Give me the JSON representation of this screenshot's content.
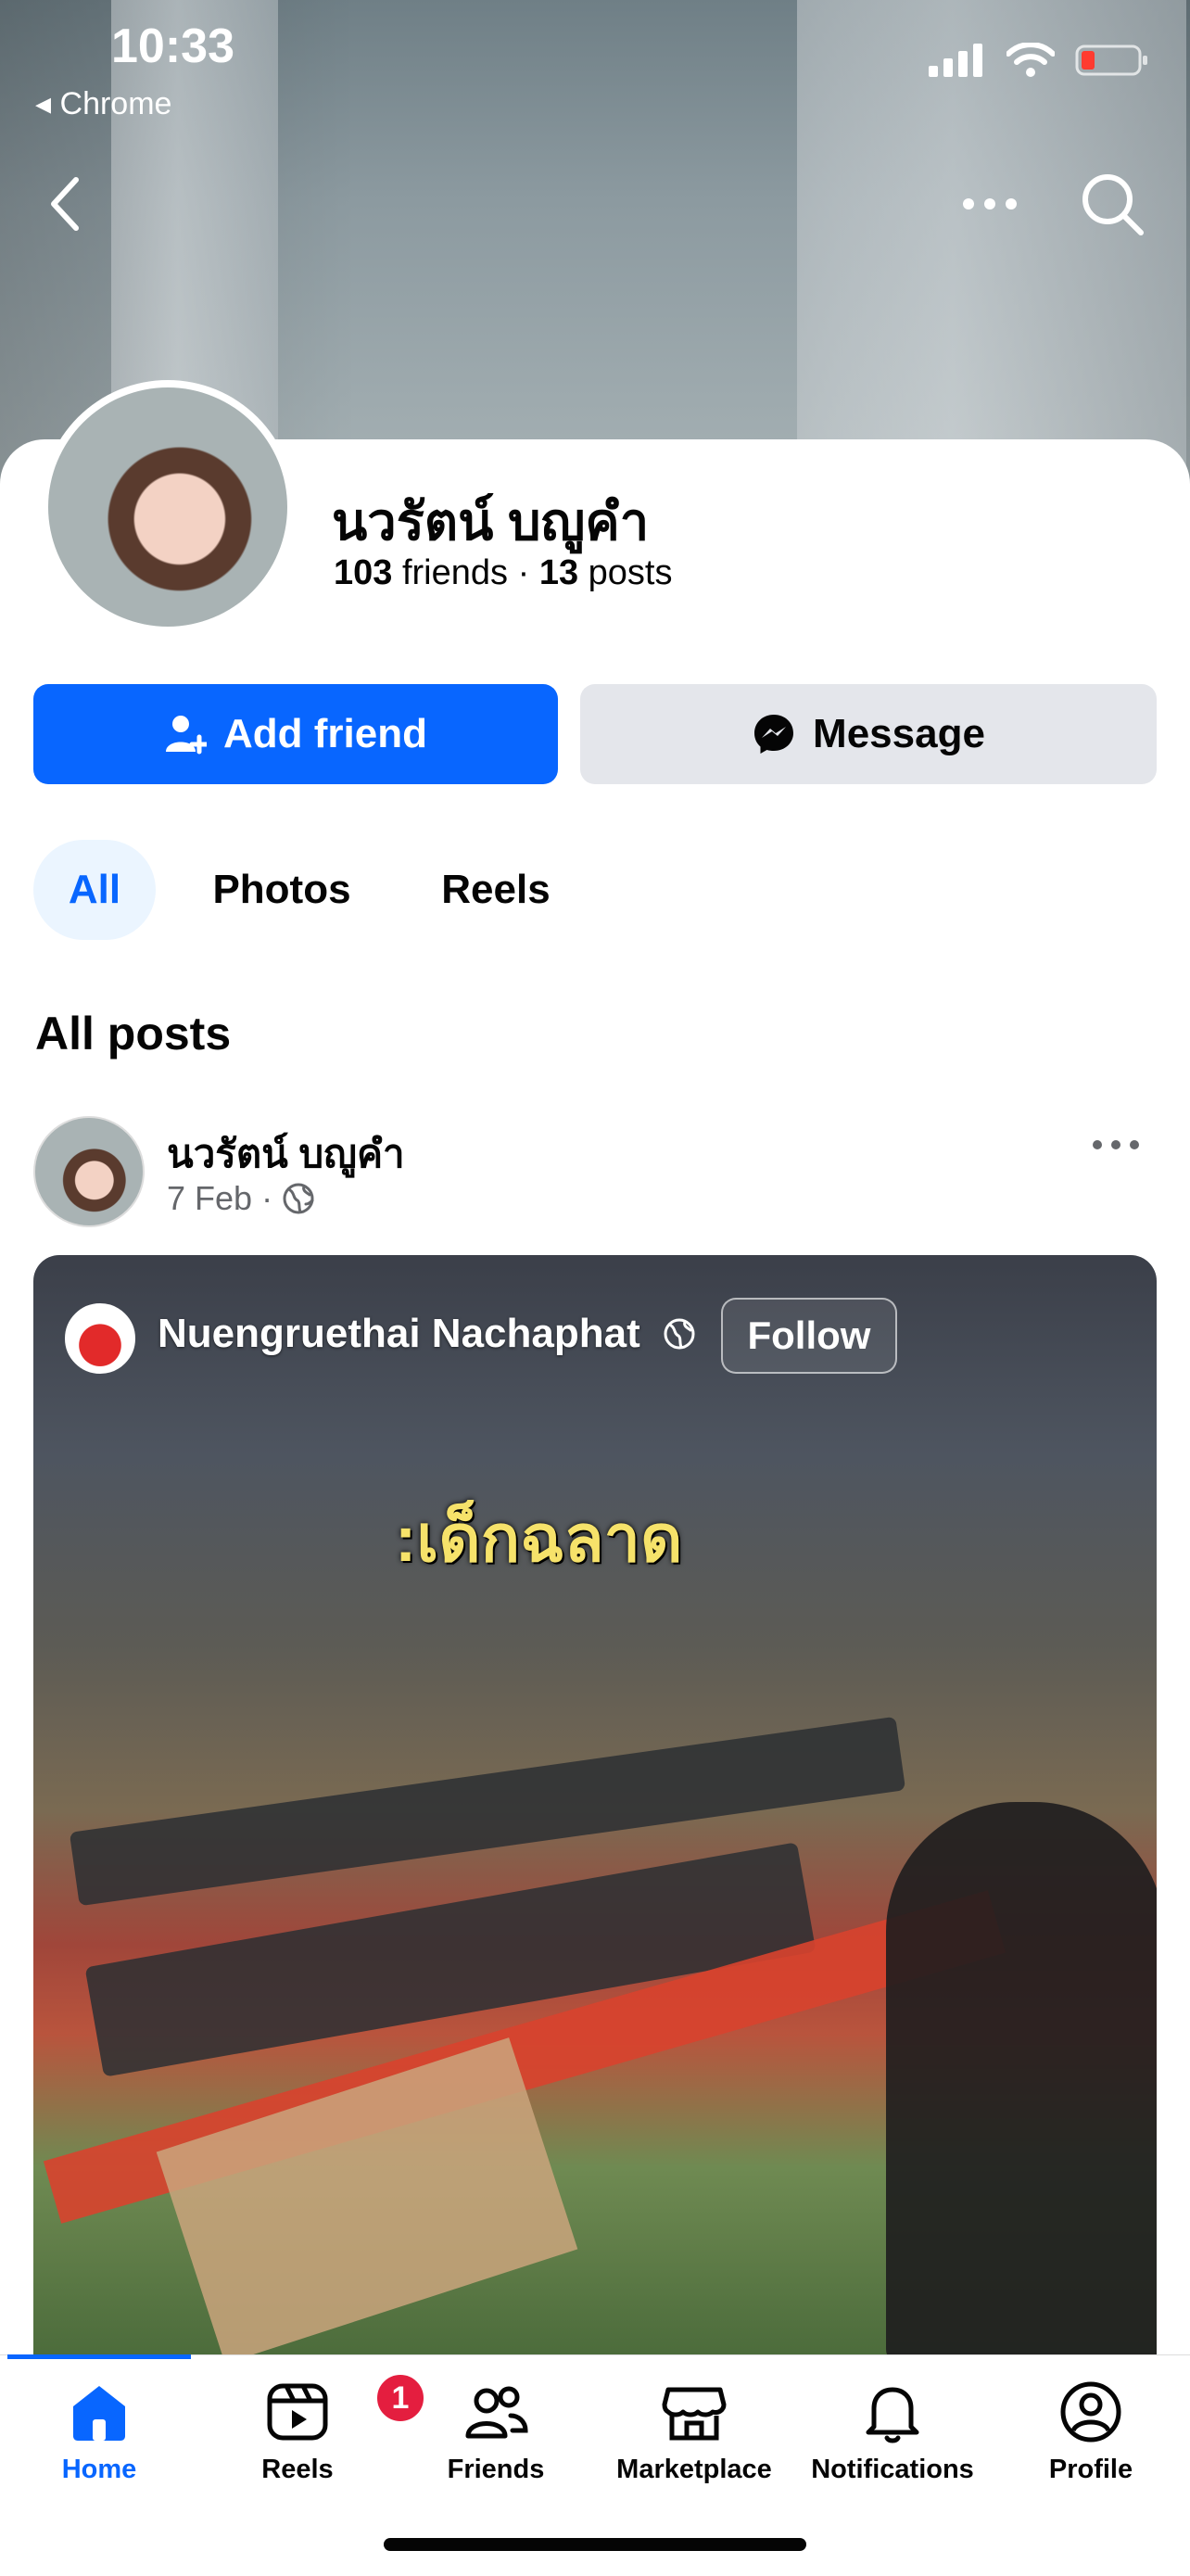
{
  "status_bar": {
    "time": "10:33",
    "back_app": "◂ Chrome"
  },
  "profile": {
    "name": "นวรัตน์ บญูคำ",
    "friends_count": "103",
    "friends_label": "friends",
    "posts_count": "13",
    "posts_label": "posts",
    "separator": "·"
  },
  "actions": {
    "add_friend": "Add friend",
    "message": "Message"
  },
  "tabs": [
    {
      "label": "All"
    },
    {
      "label": "Photos"
    },
    {
      "label": "Reels"
    }
  ],
  "section_title": "All posts",
  "post": {
    "author": "นวรัตน์ บญูคำ",
    "date": "7 Feb",
    "dot": "·",
    "shared": {
      "author": "Nuengruethai Nachaphat",
      "follow_label": "Follow",
      "overlay_text": ":เด็กฉลาด"
    }
  },
  "bottom_nav": [
    {
      "label": "Home",
      "active": true
    },
    {
      "label": "Reels",
      "badge": "1"
    },
    {
      "label": "Friends"
    },
    {
      "label": "Marketplace"
    },
    {
      "label": "Notifications"
    },
    {
      "label": "Profile"
    }
  ],
  "colors": {
    "brand": "#0866ff",
    "badge": "#e41e3f",
    "secondary_button": "#e4e6eb"
  }
}
